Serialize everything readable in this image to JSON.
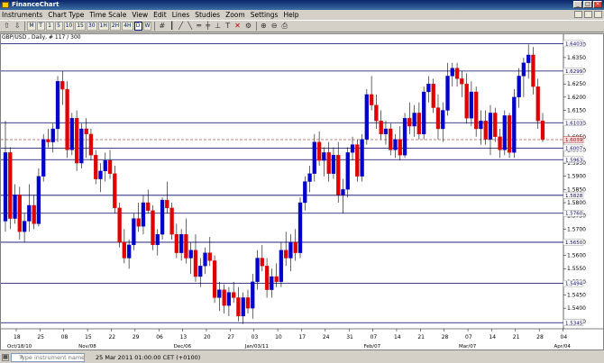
{
  "window": {
    "title": "FinanceChart"
  },
  "menu": [
    "Instruments",
    "Chart Type",
    "Time Scale",
    "View",
    "Edit",
    "Lines",
    "Studies",
    "Zoom",
    "Settings",
    "Help"
  ],
  "toolbar": {
    "timeframes": [
      "M",
      "T",
      "1",
      "5",
      "10",
      "15",
      "30",
      "1H",
      "2H",
      "4H",
      "D",
      "W"
    ],
    "selected": "D",
    "tools": [
      "crosshair-icon",
      "candles-icon",
      "line-tool-icon",
      "line-tool-icon",
      "line-tool-icon",
      "line-tool-icon",
      "line-tool-icon",
      "text-icon",
      "delete-icon",
      "tools-icon",
      "zoom-in-icon",
      "zoom-out-icon",
      "print-icon"
    ]
  },
  "chart": {
    "symbol_label": "GBP/USD , Daily, # 117 / 300",
    "price_labels": [
      "1.6400",
      "1.6350",
      "1.6300",
      "1.6250",
      "1.6200",
      "1.6150",
      "1.6100",
      "1.6050",
      "1.6000",
      "1.5950",
      "1.5900",
      "1.5850",
      "1.5800",
      "1.5750",
      "1.5700",
      "1.5650",
      "1.5600",
      "1.5550",
      "1.5500",
      "1.5450",
      "1.5400",
      "1.5350"
    ],
    "level_lines": [
      "1.6403",
      "1.6299",
      "1.6103",
      "1.6007",
      "1.5963",
      "1.5828",
      "1.5760",
      "1.5650",
      "1.5494",
      "1.5345"
    ],
    "current_price": "1.6039",
    "date_ticks": [
      "18",
      "25",
      "08",
      "15",
      "22",
      "29",
      "06",
      "13",
      "20",
      "27",
      "03",
      "10",
      "17",
      "24",
      "31",
      "07",
      "14",
      "21",
      "28",
      "07",
      "14",
      "21",
      "28",
      "04"
    ],
    "month_labels": [
      "Oct/18/10",
      "Nov/08",
      "Dec/06",
      "Jan/03/11",
      "Feb/07",
      "Mar/07",
      "Apr/04"
    ]
  },
  "chart_data": {
    "type": "candlestick",
    "title": "GBP/USD , Daily, # 117 / 300",
    "ylim": [
      1.5322,
      1.6418
    ],
    "x": [
      "Oct 18",
      "Oct 19",
      "Oct 20",
      "Oct 21",
      "Oct 22",
      "Oct 25",
      "Oct 26",
      "Oct 27",
      "Oct 28",
      "Oct 29",
      "Nov 01",
      "Nov 02",
      "Nov 03",
      "Nov 04",
      "Nov 05",
      "Nov 08",
      "Nov 09",
      "Nov 10",
      "Nov 11",
      "Nov 12",
      "Nov 15",
      "Nov 16",
      "Nov 17",
      "Nov 18",
      "Nov 19",
      "Nov 22",
      "Nov 23",
      "Nov 24",
      "Nov 25",
      "Nov 26",
      "Nov 29",
      "Nov 30",
      "Dec 01",
      "Dec 02",
      "Dec 03",
      "Dec 06",
      "Dec 07",
      "Dec 08",
      "Dec 09",
      "Dec 10",
      "Dec 13",
      "Dec 14",
      "Dec 15",
      "Dec 16",
      "Dec 17",
      "Dec 20",
      "Dec 21",
      "Dec 22",
      "Dec 23",
      "Dec 24",
      "Dec 27",
      "Dec 28",
      "Dec 29",
      "Dec 30",
      "Dec 31",
      "Jan 03",
      "Jan 04",
      "Jan 05",
      "Jan 06",
      "Jan 07",
      "Jan 10",
      "Jan 11",
      "Jan 12",
      "Jan 13",
      "Jan 14",
      "Jan 17",
      "Jan 18",
      "Jan 19",
      "Jan 20",
      "Jan 21",
      "Jan 24",
      "Jan 25",
      "Jan 26",
      "Jan 27",
      "Jan 28",
      "Jan 31",
      "Feb 01",
      "Feb 02",
      "Feb 03",
      "Feb 04",
      "Feb 07",
      "Feb 08",
      "Feb 09",
      "Feb 10",
      "Feb 11",
      "Feb 14",
      "Feb 15",
      "Feb 16",
      "Feb 17",
      "Feb 18",
      "Feb 21",
      "Feb 22",
      "Feb 23",
      "Feb 24",
      "Feb 25",
      "Feb 28",
      "Mar 01",
      "Mar 02",
      "Mar 03",
      "Mar 04",
      "Mar 07",
      "Mar 08",
      "Mar 09",
      "Mar 10",
      "Mar 11",
      "Mar 14",
      "Mar 15",
      "Mar 16",
      "Mar 17",
      "Mar 18",
      "Mar 21",
      "Mar 22",
      "Mar 23",
      "Mar 24",
      "Mar 25"
    ],
    "candles": [
      {
        "o": 1.573,
        "h": 1.611,
        "l": 1.569,
        "c": 1.599
      },
      {
        "o": 1.599,
        "h": 1.601,
        "l": 1.57,
        "c": 1.574
      },
      {
        "o": 1.574,
        "h": 1.587,
        "l": 1.572,
        "c": 1.583
      },
      {
        "o": 1.583,
        "h": 1.586,
        "l": 1.566,
        "c": 1.569
      },
      {
        "o": 1.569,
        "h": 1.576,
        "l": 1.565,
        "c": 1.573
      },
      {
        "o": 1.573,
        "h": 1.587,
        "l": 1.569,
        "c": 1.579
      },
      {
        "o": 1.579,
        "h": 1.583,
        "l": 1.57,
        "c": 1.572
      },
      {
        "o": 1.572,
        "h": 1.593,
        "l": 1.571,
        "c": 1.59
      },
      {
        "o": 1.59,
        "h": 1.606,
        "l": 1.588,
        "c": 1.604
      },
      {
        "o": 1.604,
        "h": 1.608,
        "l": 1.601,
        "c": 1.603
      },
      {
        "o": 1.603,
        "h": 1.61,
        "l": 1.599,
        "c": 1.608
      },
      {
        "o": 1.608,
        "h": 1.628,
        "l": 1.603,
        "c": 1.626
      },
      {
        "o": 1.626,
        "h": 1.63,
        "l": 1.617,
        "c": 1.623
      },
      {
        "o": 1.623,
        "h": 1.626,
        "l": 1.597,
        "c": 1.6
      },
      {
        "o": 1.6,
        "h": 1.614,
        "l": 1.598,
        "c": 1.612
      },
      {
        "o": 1.612,
        "h": 1.615,
        "l": 1.592,
        "c": 1.595
      },
      {
        "o": 1.595,
        "h": 1.61,
        "l": 1.593,
        "c": 1.608
      },
      {
        "o": 1.608,
        "h": 1.612,
        "l": 1.597,
        "c": 1.606
      },
      {
        "o": 1.606,
        "h": 1.608,
        "l": 1.596,
        "c": 1.598
      },
      {
        "o": 1.598,
        "h": 1.6,
        "l": 1.587,
        "c": 1.589
      },
      {
        "o": 1.589,
        "h": 1.595,
        "l": 1.584,
        "c": 1.592
      },
      {
        "o": 1.592,
        "h": 1.599,
        "l": 1.588,
        "c": 1.596
      },
      {
        "o": 1.596,
        "h": 1.6,
        "l": 1.589,
        "c": 1.591
      },
      {
        "o": 1.591,
        "h": 1.594,
        "l": 1.576,
        "c": 1.578
      },
      {
        "o": 1.578,
        "h": 1.58,
        "l": 1.563,
        "c": 1.565
      },
      {
        "o": 1.565,
        "h": 1.57,
        "l": 1.557,
        "c": 1.559
      },
      {
        "o": 1.559,
        "h": 1.566,
        "l": 1.555,
        "c": 1.564
      },
      {
        "o": 1.564,
        "h": 1.576,
        "l": 1.562,
        "c": 1.574
      },
      {
        "o": 1.574,
        "h": 1.58,
        "l": 1.569,
        "c": 1.571
      },
      {
        "o": 1.571,
        "h": 1.583,
        "l": 1.568,
        "c": 1.58
      },
      {
        "o": 1.58,
        "h": 1.585,
        "l": 1.576,
        "c": 1.577
      },
      {
        "o": 1.577,
        "h": 1.579,
        "l": 1.562,
        "c": 1.564
      },
      {
        "o": 1.564,
        "h": 1.57,
        "l": 1.56,
        "c": 1.568
      },
      {
        "o": 1.568,
        "h": 1.582,
        "l": 1.566,
        "c": 1.581
      },
      {
        "o": 1.581,
        "h": 1.588,
        "l": 1.576,
        "c": 1.578
      },
      {
        "o": 1.578,
        "h": 1.58,
        "l": 1.566,
        "c": 1.568
      },
      {
        "o": 1.568,
        "h": 1.572,
        "l": 1.559,
        "c": 1.561
      },
      {
        "o": 1.561,
        "h": 1.57,
        "l": 1.558,
        "c": 1.568
      },
      {
        "o": 1.568,
        "h": 1.574,
        "l": 1.557,
        "c": 1.559
      },
      {
        "o": 1.559,
        "h": 1.565,
        "l": 1.553,
        "c": 1.562
      },
      {
        "o": 1.562,
        "h": 1.568,
        "l": 1.55,
        "c": 1.552
      },
      {
        "o": 1.552,
        "h": 1.559,
        "l": 1.548,
        "c": 1.556
      },
      {
        "o": 1.556,
        "h": 1.563,
        "l": 1.553,
        "c": 1.561
      },
      {
        "o": 1.561,
        "h": 1.567,
        "l": 1.556,
        "c": 1.558
      },
      {
        "o": 1.558,
        "h": 1.56,
        "l": 1.542,
        "c": 1.544
      },
      {
        "o": 1.544,
        "h": 1.55,
        "l": 1.539,
        "c": 1.547
      },
      {
        "o": 1.547,
        "h": 1.549,
        "l": 1.538,
        "c": 1.541
      },
      {
        "o": 1.541,
        "h": 1.548,
        "l": 1.537,
        "c": 1.546
      },
      {
        "o": 1.546,
        "h": 1.55,
        "l": 1.542,
        "c": 1.544
      },
      {
        "o": 1.544,
        "h": 1.548,
        "l": 1.535,
        "c": 1.537
      },
      {
        "o": 1.537,
        "h": 1.546,
        "l": 1.534,
        "c": 1.544
      },
      {
        "o": 1.544,
        "h": 1.547,
        "l": 1.538,
        "c": 1.54
      },
      {
        "o": 1.54,
        "h": 1.553,
        "l": 1.536,
        "c": 1.55
      },
      {
        "o": 1.55,
        "h": 1.562,
        "l": 1.547,
        "c": 1.559
      },
      {
        "o": 1.559,
        "h": 1.564,
        "l": 1.554,
        "c": 1.556
      },
      {
        "o": 1.556,
        "h": 1.559,
        "l": 1.544,
        "c": 1.547
      },
      {
        "o": 1.547,
        "h": 1.555,
        "l": 1.544,
        "c": 1.552
      },
      {
        "o": 1.552,
        "h": 1.557,
        "l": 1.548,
        "c": 1.55
      },
      {
        "o": 1.55,
        "h": 1.565,
        "l": 1.548,
        "c": 1.562
      },
      {
        "o": 1.562,
        "h": 1.569,
        "l": 1.556,
        "c": 1.559
      },
      {
        "o": 1.559,
        "h": 1.568,
        "l": 1.554,
        "c": 1.565
      },
      {
        "o": 1.565,
        "h": 1.57,
        "l": 1.558,
        "c": 1.561
      },
      {
        "o": 1.561,
        "h": 1.582,
        "l": 1.559,
        "c": 1.58
      },
      {
        "o": 1.58,
        "h": 1.59,
        "l": 1.577,
        "c": 1.588
      },
      {
        "o": 1.588,
        "h": 1.594,
        "l": 1.584,
        "c": 1.591
      },
      {
        "o": 1.591,
        "h": 1.606,
        "l": 1.588,
        "c": 1.603
      },
      {
        "o": 1.603,
        "h": 1.607,
        "l": 1.594,
        "c": 1.596
      },
      {
        "o": 1.596,
        "h": 1.601,
        "l": 1.59,
        "c": 1.599
      },
      {
        "o": 1.599,
        "h": 1.603,
        "l": 1.588,
        "c": 1.591
      },
      {
        "o": 1.591,
        "h": 1.601,
        "l": 1.589,
        "c": 1.598
      },
      {
        "o": 1.598,
        "h": 1.603,
        "l": 1.58,
        "c": 1.583
      },
      {
        "o": 1.583,
        "h": 1.589,
        "l": 1.576,
        "c": 1.585
      },
      {
        "o": 1.585,
        "h": 1.601,
        "l": 1.582,
        "c": 1.599
      },
      {
        "o": 1.599,
        "h": 1.605,
        "l": 1.596,
        "c": 1.602
      },
      {
        "o": 1.602,
        "h": 1.604,
        "l": 1.588,
        "c": 1.59
      },
      {
        "o": 1.59,
        "h": 1.606,
        "l": 1.588,
        "c": 1.604
      },
      {
        "o": 1.604,
        "h": 1.623,
        "l": 1.602,
        "c": 1.621
      },
      {
        "o": 1.621,
        "h": 1.628,
        "l": 1.615,
        "c": 1.617
      },
      {
        "o": 1.617,
        "h": 1.621,
        "l": 1.608,
        "c": 1.611
      },
      {
        "o": 1.611,
        "h": 1.615,
        "l": 1.604,
        "c": 1.606
      },
      {
        "o": 1.606,
        "h": 1.611,
        "l": 1.602,
        "c": 1.608
      },
      {
        "o": 1.608,
        "h": 1.61,
        "l": 1.598,
        "c": 1.6
      },
      {
        "o": 1.6,
        "h": 1.606,
        "l": 1.597,
        "c": 1.604
      },
      {
        "o": 1.604,
        "h": 1.609,
        "l": 1.596,
        "c": 1.598
      },
      {
        "o": 1.598,
        "h": 1.614,
        "l": 1.597,
        "c": 1.612
      },
      {
        "o": 1.612,
        "h": 1.618,
        "l": 1.606,
        "c": 1.609
      },
      {
        "o": 1.609,
        "h": 1.617,
        "l": 1.605,
        "c": 1.614
      },
      {
        "o": 1.614,
        "h": 1.618,
        "l": 1.604,
        "c": 1.606
      },
      {
        "o": 1.606,
        "h": 1.624,
        "l": 1.604,
        "c": 1.622
      },
      {
        "o": 1.622,
        "h": 1.628,
        "l": 1.618,
        "c": 1.625
      },
      {
        "o": 1.625,
        "h": 1.627,
        "l": 1.614,
        "c": 1.616
      },
      {
        "o": 1.616,
        "h": 1.621,
        "l": 1.604,
        "c": 1.608
      },
      {
        "o": 1.608,
        "h": 1.618,
        "l": 1.603,
        "c": 1.615
      },
      {
        "o": 1.615,
        "h": 1.633,
        "l": 1.613,
        "c": 1.628
      },
      {
        "o": 1.628,
        "h": 1.633,
        "l": 1.624,
        "c": 1.631
      },
      {
        "o": 1.631,
        "h": 1.633,
        "l": 1.624,
        "c": 1.627
      },
      {
        "o": 1.627,
        "h": 1.63,
        "l": 1.62,
        "c": 1.625
      },
      {
        "o": 1.625,
        "h": 1.629,
        "l": 1.61,
        "c": 1.612
      },
      {
        "o": 1.612,
        "h": 1.626,
        "l": 1.609,
        "c": 1.622
      },
      {
        "o": 1.622,
        "h": 1.624,
        "l": 1.605,
        "c": 1.608
      },
      {
        "o": 1.608,
        "h": 1.615,
        "l": 1.602,
        "c": 1.611
      },
      {
        "o": 1.611,
        "h": 1.615,
        "l": 1.602,
        "c": 1.604
      },
      {
        "o": 1.604,
        "h": 1.617,
        "l": 1.598,
        "c": 1.614
      },
      {
        "o": 1.614,
        "h": 1.616,
        "l": 1.603,
        "c": 1.605
      },
      {
        "o": 1.605,
        "h": 1.608,
        "l": 1.597,
        "c": 1.6
      },
      {
        "o": 1.6,
        "h": 1.615,
        "l": 1.598,
        "c": 1.613
      },
      {
        "o": 1.613,
        "h": 1.614,
        "l": 1.597,
        "c": 1.599
      },
      {
        "o": 1.599,
        "h": 1.623,
        "l": 1.597,
        "c": 1.62
      },
      {
        "o": 1.62,
        "h": 1.631,
        "l": 1.616,
        "c": 1.628
      },
      {
        "o": 1.628,
        "h": 1.635,
        "l": 1.62,
        "c": 1.633
      },
      {
        "o": 1.633,
        "h": 1.64,
        "l": 1.627,
        "c": 1.636
      },
      {
        "o": 1.636,
        "h": 1.639,
        "l": 1.621,
        "c": 1.624
      },
      {
        "o": 1.624,
        "h": 1.627,
        "l": 1.608,
        "c": 1.611
      },
      {
        "o": 1.611,
        "h": 1.614,
        "l": 1.603,
        "c": 1.6039
      }
    ]
  },
  "status": {
    "instrument_placeholder": "Type instrument name...",
    "datetime": "25 Mar 2011 01:00:00 CET (+0100)"
  },
  "colors": {
    "up": "#0000cc",
    "down": "#e00000",
    "level_line": "#000066",
    "current_line": "#880000",
    "chart_bg": "#ffffff"
  }
}
